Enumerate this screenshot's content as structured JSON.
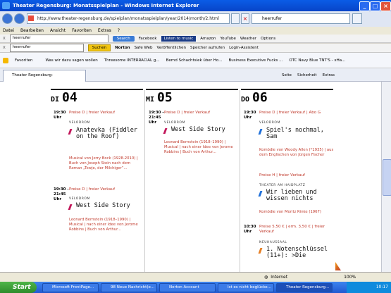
{
  "window": {
    "title": "Theater Regensburg: Monatsspielplan - Windows Internet Explorer"
  },
  "address": {
    "url": "http://www.theater-regensburg.de/spielplan/monatsspielplan/year/2014/month/2.html",
    "search_value": "heerrufer"
  },
  "menu": [
    "Datei",
    "Bearbeiten",
    "Ansicht",
    "Favoriten",
    "Extras",
    "?"
  ],
  "toolbar1": {
    "search_value": "heerrufer",
    "search_btn": "Search",
    "items": [
      "Facebook",
      "Listen to music",
      "Amazon",
      "YouTube",
      "Weather",
      "Options"
    ]
  },
  "toolbar2": {
    "search_value": "heerrufer",
    "search_btn": "Suchen",
    "items": [
      "Norton",
      "Safe Web",
      "Veröffentlichen",
      "Speicher aufrufen",
      "Login-Assistent"
    ]
  },
  "favorites": {
    "label": "Favoriten",
    "items": [
      "Was wir dazu sagen wollen",
      "Threesome INTERRACIAL g...",
      "Bernd Schachtsiek über Ho...",
      "Business Executive Fucks ...",
      "OTC Navy Blue TNT'S - xHa..."
    ]
  },
  "tab": {
    "label": "Theater Regensburg: Monatsspielplan",
    "cmds": [
      "Seite",
      "Sicherheit",
      "Extras"
    ]
  },
  "days": [
    {
      "weekday": "DI",
      "num": "04"
    },
    {
      "weekday": "MI",
      "num": "05"
    },
    {
      "weekday": "DO",
      "num": "06"
    }
  ],
  "events": {
    "d1e1": {
      "time": "19:30 Uhr",
      "price": "Preise D | freier Verkauf",
      "venue": "VELODROM",
      "title": "Anatevka (Fiddler on the Roof)",
      "desc": "Musical von Jerry Bock (1928-2010) | Buch von Joseph Stein nach dem Roman „Tewje, der Milchiger“..."
    },
    "d1e2": {
      "time": "19:30 - 21:45 Uhr",
      "price": "Preise D | freier Verkauf",
      "venue": "VELODROM",
      "title": "West Side Story",
      "desc": "Leonard Bernstein (1918–1990) | Musical | nach einer Idee von Jerome Robbins | Buch von Arthur..."
    },
    "d2e1": {
      "time": "19:30 - 21:45 Uhr",
      "price": "Preise D | freier Verkauf",
      "venue": "VELODROM",
      "title": "West Side Story",
      "desc": "Leonard Bernstein (1918–1990) | Musical | nach einer Idee von Jerome Robbins | Buch von Arthur..."
    },
    "d3e1": {
      "time": "19:30 Uhr",
      "price": "Preise D | freier Verkauf | Abo G",
      "venue": "VELODROM",
      "title": "Spiel's nochmal, Sam",
      "desc": "Komödie von Woody Allen (*1935) | aus dem Englischen von Jürgen Fischer"
    },
    "d3e2": {
      "price": "Preise H | freier Verkauf",
      "venue": "THEATER AM HAIDPLATZ",
      "title": "Wir lieben und wissen nichts",
      "desc": "Komödie von Moritz Rinke (1967)"
    },
    "d3e3": {
      "time": "10:30 Uhr",
      "price": "Preise 5,50 € | erm. 3,50 € | freier Verkauf",
      "venue": "NEUHAUSSAAL",
      "title": "1. Notenschlüssel (11+): >Die"
    }
  },
  "status": {
    "zone": "Internet",
    "zoom": "100%"
  },
  "taskbar": {
    "start": "Start",
    "tasks": [
      "Microsoft FrontPage...",
      "98 Neue Nachricht(e...",
      "Norton Account",
      "Ist es nicht beglücke...",
      "Theater Regensburg..."
    ],
    "clock": "10:17"
  },
  "colors": {
    "accent_red": "#c0392b",
    "bar_pink": "#c2185b",
    "bar_blue": "#1e6fd9",
    "bar_orange": "#e67e22"
  }
}
